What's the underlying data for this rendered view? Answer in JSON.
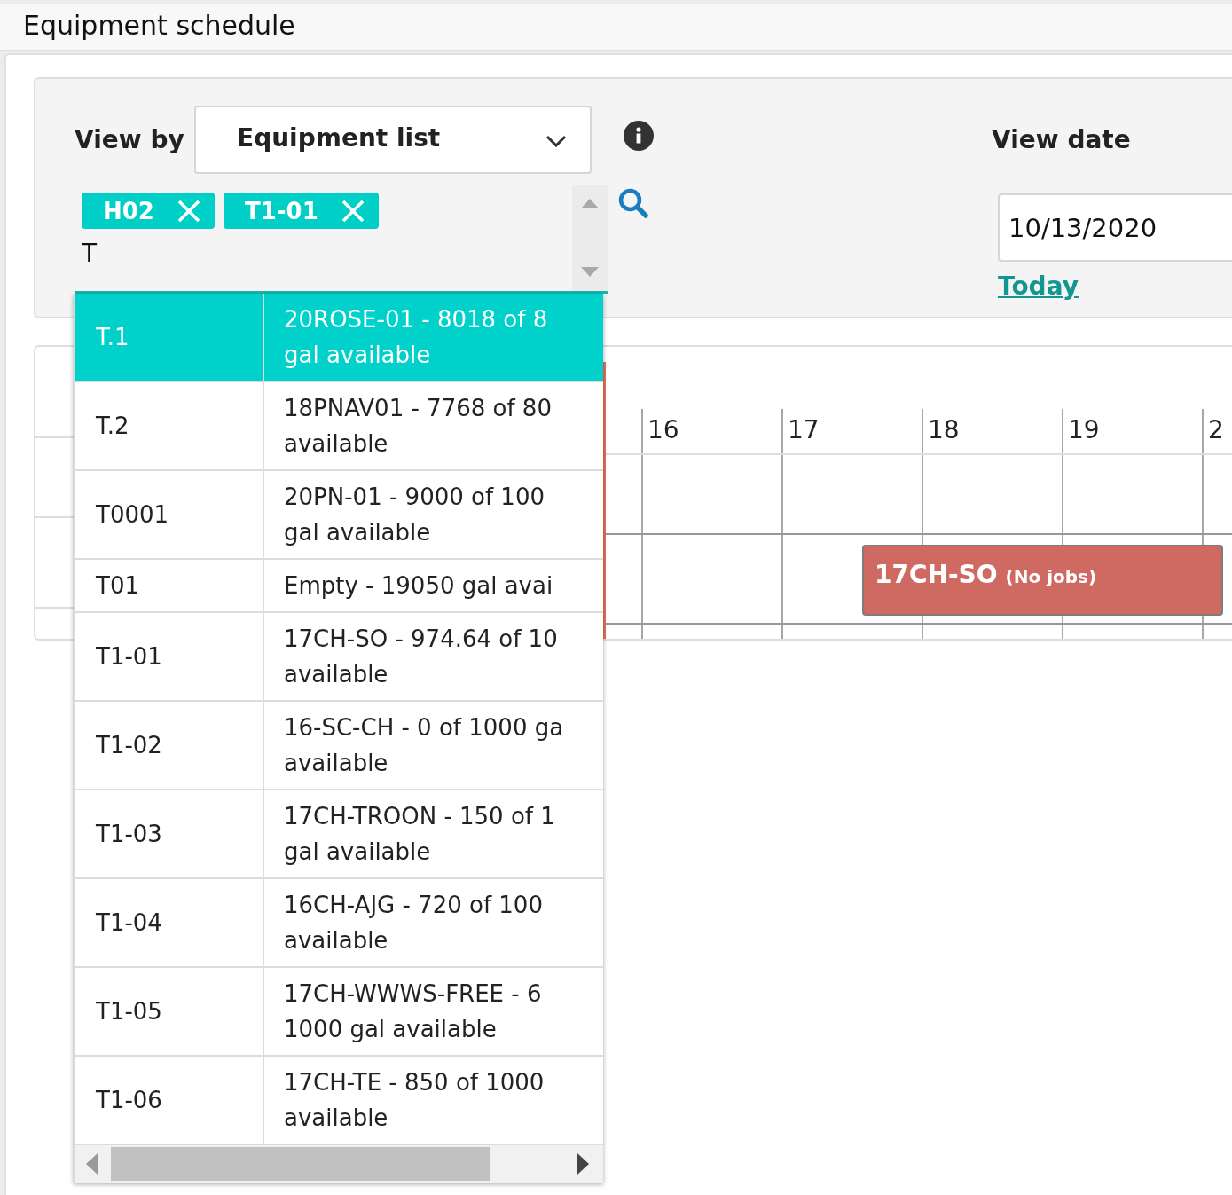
{
  "header": {
    "title": "Equipment schedule"
  },
  "filters": {
    "view_by": {
      "label": "View by",
      "value": "Equipment list"
    },
    "equipment": {
      "tags": [
        {
          "label": "H02"
        },
        {
          "label": "T1-01"
        }
      ],
      "value": "T"
    },
    "view_date": {
      "label": "View date",
      "value": "10/13/2020",
      "link": "Today"
    }
  },
  "equipment_dropdown": {
    "rows": [
      {
        "code": "T.1",
        "lines": [
          "20ROSE-01 - 8018 of 8",
          "gal available"
        ],
        "selected": true
      },
      {
        "code": "T.2",
        "lines": [
          "18PNAV01 - 7768 of 80",
          "available"
        ],
        "selected": false
      },
      {
        "code": "T0001",
        "lines": [
          "20PN-01 - 9000 of 100",
          "gal available"
        ],
        "selected": false
      },
      {
        "code": "T01",
        "lines": [
          "Empty - 19050 gal avai"
        ],
        "selected": false
      },
      {
        "code": "T1-01",
        "lines": [
          "17CH-SO - 974.64 of 10",
          "available"
        ],
        "selected": false
      },
      {
        "code": "T1-02",
        "lines": [
          "16-SC-CH - 0 of 1000 ga",
          "available"
        ],
        "selected": false
      },
      {
        "code": "T1-03",
        "lines": [
          "17CH-TROON - 150 of 1",
          "gal available"
        ],
        "selected": false
      },
      {
        "code": "T1-04",
        "lines": [
          "16CH-AJG - 720 of 100",
          "available"
        ],
        "selected": false
      },
      {
        "code": "T1-05",
        "lines": [
          "17CH-WWWS-FREE - 6",
          "1000 gal available"
        ],
        "selected": false
      },
      {
        "code": "T1-06",
        "lines": [
          "17CH-TE - 850 of 1000",
          "available"
        ],
        "selected": false
      }
    ]
  },
  "schedule": {
    "days": [
      "16",
      "17",
      "18",
      "19",
      "2"
    ],
    "events": [
      {
        "title": "17CH-SO",
        "note": "(No jobs)"
      }
    ]
  }
}
